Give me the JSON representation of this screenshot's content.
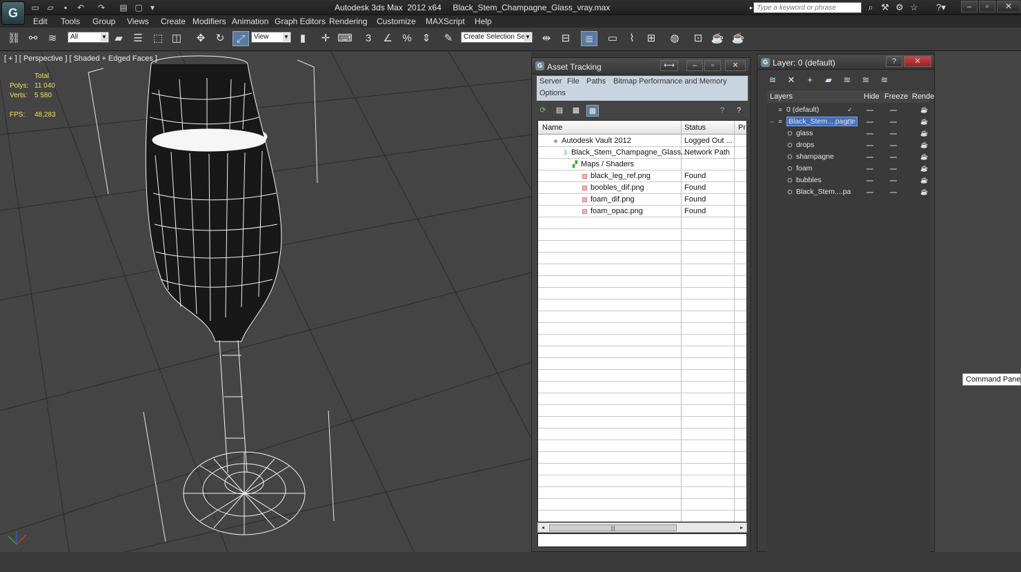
{
  "app": {
    "title": "Autodesk 3ds Max  2012 x64     Black_Stem_Champagne_Glass_vray.max",
    "logo": "G",
    "search_placeholder": "Type a keyword or phrase"
  },
  "menu": [
    "Edit",
    "Tools",
    "Group",
    "Views",
    "Create",
    "Modifiers",
    "Animation",
    "Graph Editors",
    "Rendering",
    "Customize",
    "MAXScript",
    "Help"
  ],
  "toolbar": {
    "selection_filter": "All",
    "ref_coord": "View",
    "named_selection": "Create Selection Se"
  },
  "viewport": {
    "label": "[ + ] [ Perspective ] [ Shaded + Edged Faces ]",
    "stats": {
      "total_label": "Total",
      "polys_label": "Polys:",
      "polys_value": "11 040",
      "verts_label": "Verts:",
      "verts_value": "5 580",
      "fps_label": "FPS:",
      "fps_value": "48,283"
    }
  },
  "asset_tracking": {
    "title": "Asset Tracking",
    "menu": [
      "Server",
      "File",
      "Paths",
      "Bitmap Performance and Memory",
      "Options"
    ],
    "columns": [
      "Name",
      "Status",
      "Pr"
    ],
    "rows": [
      {
        "name": "Autodesk Vault 2012",
        "status": "Logged Out ...",
        "icon": "vault-icon"
      },
      {
        "name": "Black_Stem_Champagne_Glass...",
        "status": "Network Path",
        "icon": "max-file-icon"
      },
      {
        "name": "Maps / Shaders",
        "status": "",
        "icon": "maps-icon"
      },
      {
        "name": "black_leg_ref.png",
        "status": "Found",
        "icon": "image-file-icon"
      },
      {
        "name": "boobles_dif.png",
        "status": "Found",
        "icon": "image-file-icon"
      },
      {
        "name": "foam_dif.png",
        "status": "Found",
        "icon": "image-file-icon"
      },
      {
        "name": "foam_opac.png",
        "status": "Found",
        "icon": "image-file-icon"
      }
    ]
  },
  "layer_explorer": {
    "title": "Layer: 0 (default)",
    "columns": [
      "Layers",
      "Hide",
      "Freeze",
      "Rende"
    ],
    "rows": [
      {
        "name": "0 (default)",
        "level": 0
      },
      {
        "name": "Black_Stem....pagne",
        "level": 0
      },
      {
        "name": "glass",
        "level": 1
      },
      {
        "name": "drops",
        "level": 1
      },
      {
        "name": "shampagne",
        "level": 1
      },
      {
        "name": "foam",
        "level": 1
      },
      {
        "name": "bubbles",
        "level": 1
      },
      {
        "name": "Black_Stem....pa",
        "level": 1
      }
    ]
  },
  "command_panel_tooltip": "Command Panel"
}
